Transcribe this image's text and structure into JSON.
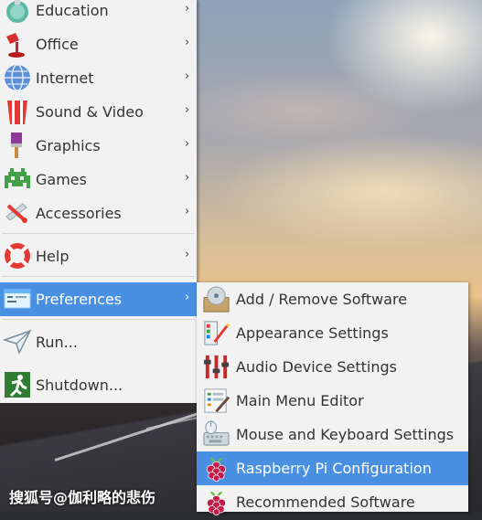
{
  "main_menu": {
    "items": [
      {
        "label": "Education",
        "icon": "education-icon",
        "has_submenu": true
      },
      {
        "label": "Office",
        "icon": "office-icon",
        "has_submenu": true
      },
      {
        "label": "Internet",
        "icon": "internet-icon",
        "has_submenu": true
      },
      {
        "label": "Sound & Video",
        "icon": "sound-video-icon",
        "has_submenu": true
      },
      {
        "label": "Graphics",
        "icon": "graphics-icon",
        "has_submenu": true
      },
      {
        "label": "Games",
        "icon": "games-icon",
        "has_submenu": true
      },
      {
        "label": "Accessories",
        "icon": "accessories-icon",
        "has_submenu": true
      },
      {
        "label": "Help",
        "icon": "help-icon",
        "has_submenu": true
      },
      {
        "label": "Preferences",
        "icon": "preferences-icon",
        "has_submenu": true,
        "active": true
      },
      {
        "label": "Run...",
        "icon": "run-icon",
        "has_submenu": false
      },
      {
        "label": "Shutdown...",
        "icon": "shutdown-icon",
        "has_submenu": false
      }
    ],
    "arrow_glyph": "›"
  },
  "preferences_submenu": {
    "items": [
      {
        "label": "Add / Remove Software",
        "icon": "package-disc-icon"
      },
      {
        "label": "Appearance Settings",
        "icon": "appearance-settings-icon"
      },
      {
        "label": "Audio Device Settings",
        "icon": "audio-mixer-icon"
      },
      {
        "label": "Main Menu Editor",
        "icon": "menu-editor-icon"
      },
      {
        "label": "Mouse and Keyboard Settings",
        "icon": "mouse-keyboard-icon"
      },
      {
        "label": "Raspberry Pi Configuration",
        "icon": "raspberry-pi-icon",
        "active": true
      },
      {
        "label": "Recommended Software",
        "icon": "raspberry-pi-icon"
      }
    ]
  },
  "watermark": "搜狐号@伽利略的悲伤",
  "colors": {
    "highlight": "#4a90e2",
    "menu_bg": "#f2f2f2",
    "text": "#333333"
  }
}
